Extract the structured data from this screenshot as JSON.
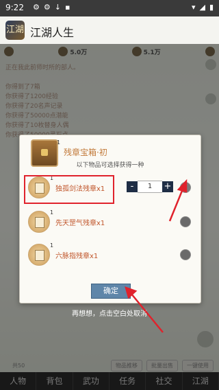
{
  "status": {
    "time": "9:22"
  },
  "app": {
    "title": "江湖人生",
    "logo_text": "江湖"
  },
  "resources": [
    "5.0万",
    "5.1万"
  ],
  "log": [
    "正在我此前师时所的部人。",
    "",
    "你得到了7箱",
    "你获得了1200经验",
    "你获得了20名声记录",
    "你获得了50000点潜能",
    "你获得了10枚替身人偶",
    "你获得了50000灵石点"
  ],
  "dialog": {
    "chest_count": "1",
    "title": "残章宝箱·初",
    "subtitle": "以下物品可选择获得一种",
    "items": [
      {
        "name": "独孤剑法残章x1",
        "count": "1"
      },
      {
        "name": "先天罡气残章x1",
        "count": "1"
      },
      {
        "name": "六脉指残章x1",
        "count": "1"
      }
    ],
    "stepper": {
      "minus": "-",
      "value": "1",
      "plus": "+"
    },
    "confirm": "确定"
  },
  "cancel_hint": "再想想，点击空白处取消",
  "bottom": {
    "page_info": "共50",
    "buttons": [
      "物品推移",
      "批量出售",
      "一键使用"
    ]
  },
  "nav": [
    "人物",
    "背包",
    "武功",
    "任务",
    "社交",
    "江湖"
  ],
  "colors": {
    "highlight": "#e0222c",
    "confirm": "#5f86a9",
    "title": "#c27a3a"
  }
}
